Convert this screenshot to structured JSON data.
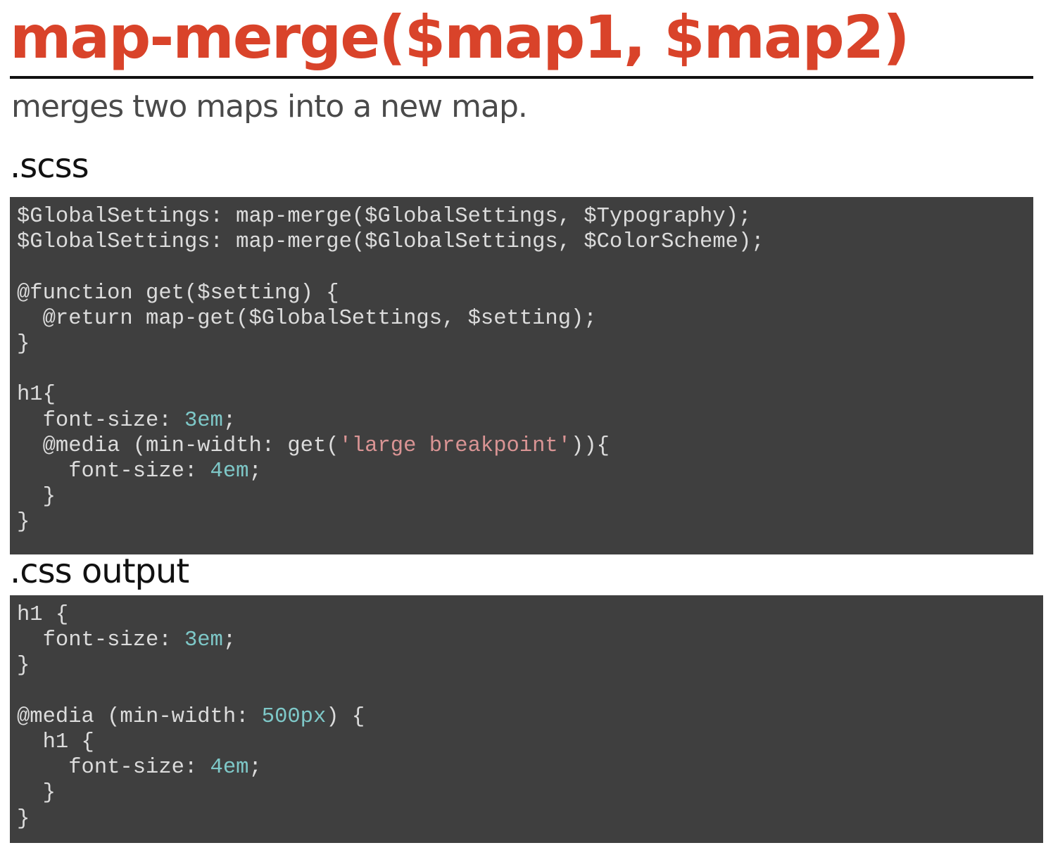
{
  "page": {
    "title": "map-merge($map1, $map2)",
    "subtitle": "merges two maps into a new map."
  },
  "sections": {
    "scss_heading": ".scss",
    "css_heading": ".css output"
  },
  "colors": {
    "title": "#d9432a",
    "code_background": "#3f3f3f",
    "code_text": "#dcdcdc",
    "code_number": "#7ec8c8",
    "code_string": "#d99494"
  },
  "code": {
    "scss": [
      [
        {
          "t": "$GlobalSettings: map-merge($GlobalSettings, $Typography);",
          "k": "default"
        }
      ],
      [
        {
          "t": "$GlobalSettings: map-merge($GlobalSettings, $ColorScheme);",
          "k": "default"
        }
      ],
      [],
      [
        {
          "t": "@function get($setting) {",
          "k": "default"
        }
      ],
      [
        {
          "t": "  @return map-get($GlobalSettings, $setting);",
          "k": "default"
        }
      ],
      [
        {
          "t": "}",
          "k": "default"
        }
      ],
      [],
      [
        {
          "t": "h1{",
          "k": "default"
        }
      ],
      [
        {
          "t": "  font-size: ",
          "k": "default"
        },
        {
          "t": "3em",
          "k": "number"
        },
        {
          "t": ";",
          "k": "default"
        }
      ],
      [
        {
          "t": "  @media (min-width: get(",
          "k": "default"
        },
        {
          "t": "'large breakpoint'",
          "k": "string"
        },
        {
          "t": ")){",
          "k": "default"
        }
      ],
      [
        {
          "t": "    font-size: ",
          "k": "default"
        },
        {
          "t": "4em",
          "k": "number"
        },
        {
          "t": ";",
          "k": "default"
        }
      ],
      [
        {
          "t": "  }",
          "k": "default"
        }
      ],
      [
        {
          "t": "}",
          "k": "default"
        }
      ]
    ],
    "css": [
      [
        {
          "t": "h1 {",
          "k": "default"
        }
      ],
      [
        {
          "t": "  font-size: ",
          "k": "default"
        },
        {
          "t": "3em",
          "k": "number"
        },
        {
          "t": ";",
          "k": "default"
        }
      ],
      [
        {
          "t": "}",
          "k": "default"
        }
      ],
      [],
      [
        {
          "t": "@media (min-width: ",
          "k": "default"
        },
        {
          "t": "500px",
          "k": "number"
        },
        {
          "t": ") {",
          "k": "default"
        }
      ],
      [
        {
          "t": "  h1 {",
          "k": "default"
        }
      ],
      [
        {
          "t": "    font-size: ",
          "k": "default"
        },
        {
          "t": "4em",
          "k": "number"
        },
        {
          "t": ";",
          "k": "default"
        }
      ],
      [
        {
          "t": "  }",
          "k": "default"
        }
      ],
      [
        {
          "t": "}",
          "k": "default"
        }
      ]
    ]
  }
}
